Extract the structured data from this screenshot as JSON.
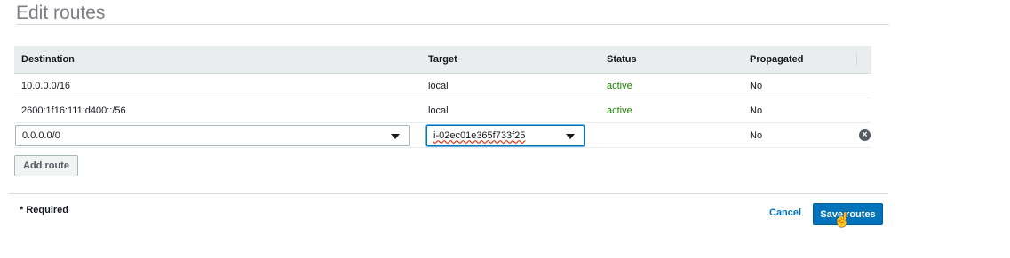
{
  "page": {
    "title": "Edit routes"
  },
  "table": {
    "headers": [
      "Destination",
      "Target",
      "Status",
      "Propagated"
    ],
    "rows": [
      {
        "destination": "10.0.0.0/16",
        "target": "local",
        "status": "active",
        "propagated": "No"
      },
      {
        "destination": "2600:1f16:111:d400::/56",
        "target": "local",
        "status": "active",
        "propagated": "No"
      }
    ],
    "edit_row": {
      "destination": "0.0.0.0/0",
      "target": "i-02ec01e365f733f25",
      "status": "",
      "propagated": "No"
    }
  },
  "actions": {
    "add_route": "Add route",
    "required_note": "* Required",
    "cancel": "Cancel",
    "save": "Save routes"
  },
  "colors": {
    "accent": "#0073bb",
    "status_active": "#1d8102",
    "title": "#7b7f85"
  },
  "icons": {
    "remove": "close-circle-icon",
    "dropdown": "caret-down-icon",
    "cursor": "hand-pointer-icon"
  }
}
